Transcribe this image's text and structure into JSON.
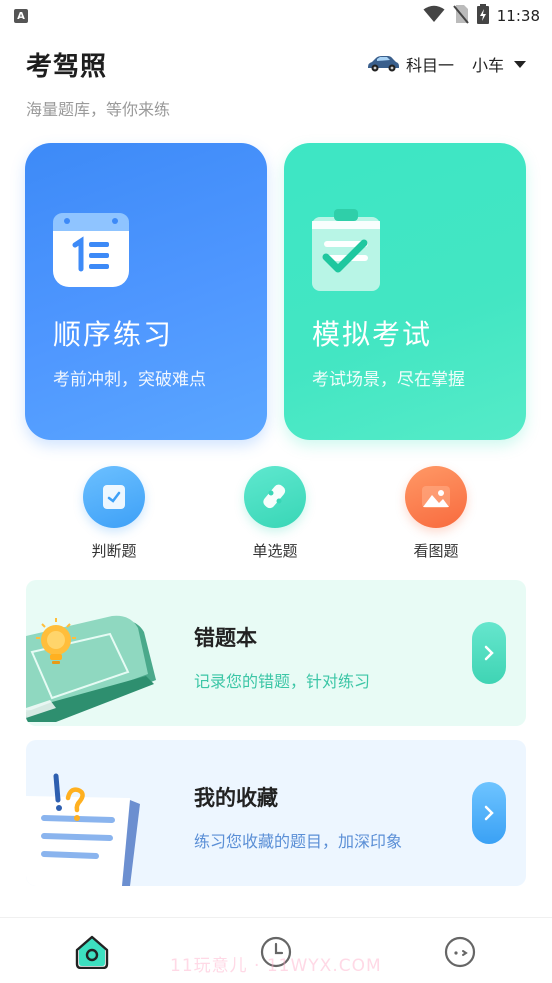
{
  "status_bar": {
    "notification_icon": "A",
    "time": "11:38",
    "icons": [
      "wifi-icon",
      "no-sim-icon",
      "battery-charging-icon"
    ]
  },
  "header": {
    "title": "考驾照",
    "subject": "科目一",
    "vehicle": "小车",
    "car_icon": "car-icon",
    "caret_icon": "caret-down-icon"
  },
  "subtitle": "海量题库，等你来练",
  "cards": {
    "sequential": {
      "title": "顺序练习",
      "desc": "考前冲刺，突破难点",
      "icon": "list-calendar-icon"
    },
    "mock": {
      "title": "模拟考试",
      "desc": "考试场景，尽在掌握",
      "icon": "clipboard-check-icon"
    }
  },
  "quick": [
    {
      "label": "判断题",
      "icon": "judge-icon"
    },
    {
      "label": "单选题",
      "icon": "single-choice-icon"
    },
    {
      "label": "看图题",
      "icon": "image-icon"
    }
  ],
  "wrong_book": {
    "title": "错题本",
    "desc": "记录您的错题，针对练习",
    "arrow": "chevron-right-icon"
  },
  "favorites": {
    "title": "我的收藏",
    "desc": "练习您收藏的题目，加深印象",
    "arrow": "chevron-right-icon"
  },
  "bottom_nav": {
    "items": [
      "home-icon",
      "history-icon",
      "profile-icon"
    ],
    "watermark": "11玩意儿 · 11WYX.COM"
  },
  "colors": {
    "blue": "#4a96ff",
    "teal": "#43e6c3",
    "orange": "#f8773f"
  }
}
